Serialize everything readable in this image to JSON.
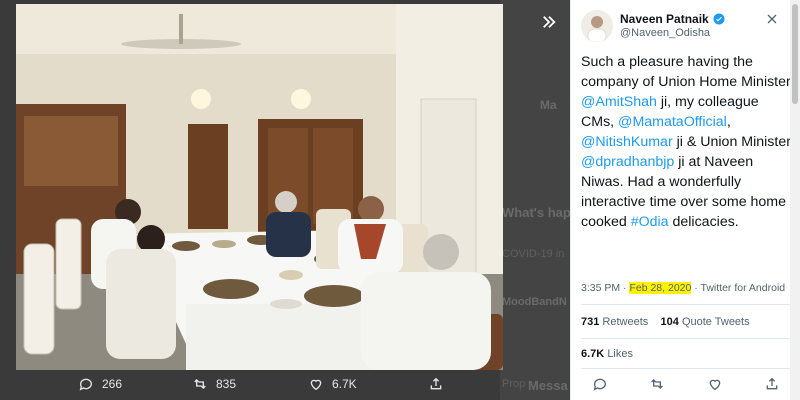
{
  "tweet": {
    "author_name": "Naveen Patnaik",
    "author_handle": "@Naveen_Odisha",
    "text_parts": [
      "Such a pleasure having the company of Union Home Minister ",
      "@AmitShah",
      " ji, my colleague CMs, ",
      "@MamataOfficial",
      ", ",
      "@NitishKumar",
      " ji & Union Minister ",
      "@dpradhanbjp",
      " ji at Naveen Niwas. Had a wonderfully interactive time over some home cooked ",
      "#Odia",
      " delicacies."
    ],
    "time": "3:35 PM",
    "dot": "·",
    "date": "Feb 28, 2020",
    "source": "· Twitter for Android",
    "retweets_count": "731",
    "retweets_label": "Retweets",
    "quote_count": "104",
    "quote_label": "Quote Tweets",
    "likes_count": "6.7K",
    "likes_label": "Likes"
  },
  "photo_actions": {
    "reply_count": "266",
    "retweet_count": "835",
    "like_count": "6.7K"
  },
  "background": {
    "whats_happening": "What's happening",
    "covid": "COVID-19 in",
    "mood": "MoodBandN",
    "mess": "Messa",
    "prop": "Prop",
    "ma": "Ma"
  },
  "colors": {
    "accent": "#1d9bf0",
    "highlight": "#fff200"
  },
  "icons": {
    "expand": "chevron-double-right-icon",
    "close": "close-icon",
    "verified": "verified-badge-icon"
  }
}
